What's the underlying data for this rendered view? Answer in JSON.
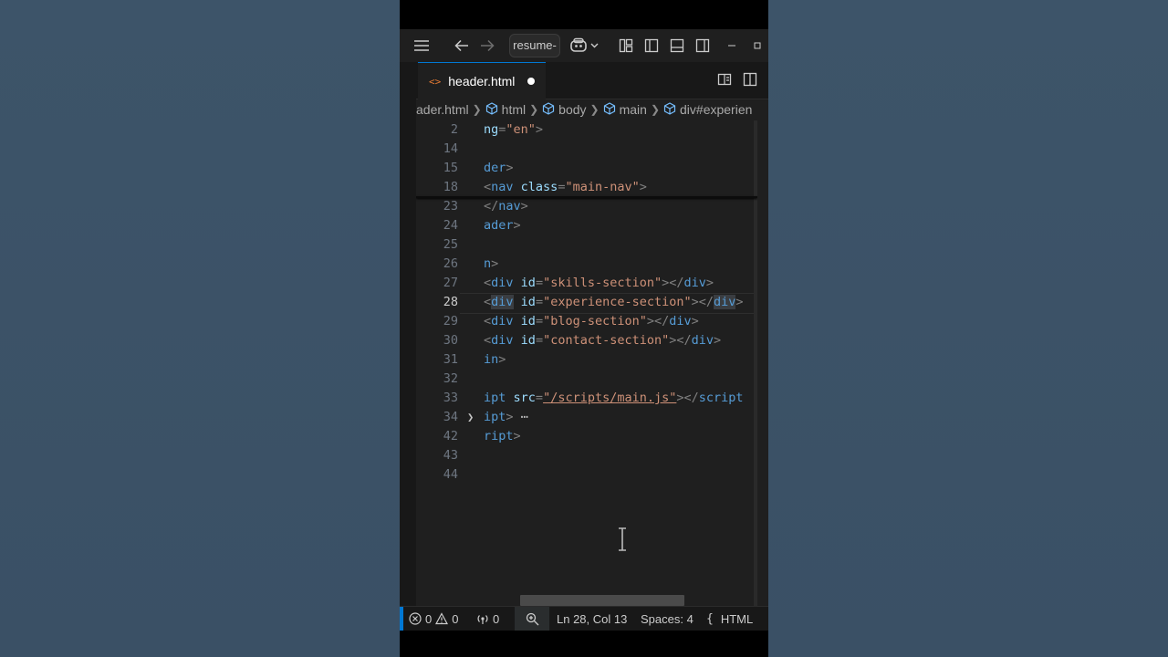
{
  "colors": {
    "backdrop": "#3b5266",
    "editor_bg": "#1f1f1f",
    "accent": "#0078d4",
    "tag": "#569cd6",
    "attribute": "#9cdcfe",
    "string": "#ce9178",
    "file_icon": "#e37933"
  },
  "titlebar": {
    "command_center_label": "resume-",
    "icons": [
      "menu-icon",
      "back-arrow-icon",
      "forward-arrow-icon",
      "copilot-icon",
      "chevron-down-icon",
      "layout-icon",
      "sidebar-left-icon",
      "panel-bottom-icon",
      "sidebar-right-icon",
      "minimize-icon",
      "maximize-icon"
    ]
  },
  "tab": {
    "file_icon_glyph": "<>",
    "label": "header.html",
    "dirty": true
  },
  "breadcrumb": {
    "items": [
      "ader.html",
      "html",
      "body",
      "main",
      "div#experien"
    ]
  },
  "editor": {
    "lines": [
      {
        "num": "2",
        "tokens": [
          [
            "attr",
            "ng"
          ],
          [
            "brk",
            "="
          ],
          [
            "str",
            "\"en\""
          ],
          [
            "brk",
            ">"
          ]
        ]
      },
      {
        "num": "14",
        "tokens": []
      },
      {
        "num": "15",
        "tokens": [
          [
            "tag",
            "der"
          ],
          [
            "brk",
            ">"
          ]
        ]
      },
      {
        "num": "18",
        "tokens": [
          [
            "brk",
            "<"
          ],
          [
            "tag",
            "nav"
          ],
          [
            "txt",
            " "
          ],
          [
            "attr",
            "class"
          ],
          [
            "brk",
            "="
          ],
          [
            "str",
            "\"main-nav\""
          ],
          [
            "brk",
            ">"
          ]
        ]
      },
      {
        "num": "23",
        "tokens": [
          [
            "brk",
            "</"
          ],
          [
            "tag",
            "nav"
          ],
          [
            "brk",
            ">"
          ]
        ]
      },
      {
        "num": "24",
        "tokens": [
          [
            "tag",
            "ader"
          ],
          [
            "brk",
            ">"
          ]
        ]
      },
      {
        "num": "25",
        "tokens": []
      },
      {
        "num": "26",
        "tokens": [
          [
            "tag",
            "n"
          ],
          [
            "brk",
            ">"
          ]
        ]
      },
      {
        "num": "27",
        "tokens": [
          [
            "brk",
            "<"
          ],
          [
            "tag",
            "div"
          ],
          [
            "txt",
            " "
          ],
          [
            "attr",
            "id"
          ],
          [
            "brk",
            "="
          ],
          [
            "str",
            "\"skills-section\""
          ],
          [
            "brk",
            "></"
          ],
          [
            "tag",
            "div"
          ],
          [
            "brk",
            ">"
          ]
        ]
      },
      {
        "num": "28",
        "tokens": [
          [
            "brk",
            "<"
          ],
          [
            "tag hl",
            "div"
          ],
          [
            "txt",
            " "
          ],
          [
            "attr",
            "id"
          ],
          [
            "brk",
            "="
          ],
          [
            "str",
            "\"experience-section\""
          ],
          [
            "brk",
            "></"
          ],
          [
            "tag hl",
            "div"
          ],
          [
            "brk",
            ">"
          ]
        ],
        "active": true
      },
      {
        "num": "29",
        "tokens": [
          [
            "brk",
            "<"
          ],
          [
            "tag",
            "div"
          ],
          [
            "txt",
            " "
          ],
          [
            "attr",
            "id"
          ],
          [
            "brk",
            "="
          ],
          [
            "str",
            "\"blog-section\""
          ],
          [
            "brk",
            "></"
          ],
          [
            "tag",
            "div"
          ],
          [
            "brk",
            ">"
          ]
        ]
      },
      {
        "num": "30",
        "tokens": [
          [
            "brk",
            "<"
          ],
          [
            "tag",
            "div"
          ],
          [
            "txt",
            " "
          ],
          [
            "attr",
            "id"
          ],
          [
            "brk",
            "="
          ],
          [
            "str",
            "\"contact-section\""
          ],
          [
            "brk",
            "></"
          ],
          [
            "tag",
            "div"
          ],
          [
            "brk",
            ">"
          ]
        ]
      },
      {
        "num": "31",
        "tokens": [
          [
            "tag",
            "in"
          ],
          [
            "brk",
            ">"
          ]
        ]
      },
      {
        "num": "32",
        "tokens": []
      },
      {
        "num": "33",
        "tokens": [
          [
            "tag",
            "ipt"
          ],
          [
            "txt",
            " "
          ],
          [
            "attr",
            "src"
          ],
          [
            "brk",
            "="
          ],
          [
            "str",
            "\"/scripts/main.js\""
          ],
          [
            "brk",
            "></"
          ],
          [
            "tag",
            "script"
          ]
        ]
      },
      {
        "num": "34",
        "tokens": [
          [
            "tag",
            "ipt"
          ],
          [
            "brk",
            ">"
          ],
          [
            "ellipsis",
            " ⋯"
          ]
        ],
        "folded": true
      },
      {
        "num": "42",
        "tokens": [
          [
            "tag",
            "ript"
          ],
          [
            "brk",
            ">"
          ]
        ]
      },
      {
        "num": "43",
        "tokens": []
      },
      {
        "num": "44",
        "tokens": []
      }
    ]
  },
  "statusbar": {
    "errors": "0",
    "warnings": "0",
    "ports": "0",
    "position": "Ln 28, Col 13",
    "spaces": "Spaces: 4",
    "language_glyph": "{",
    "language": "HTML"
  }
}
